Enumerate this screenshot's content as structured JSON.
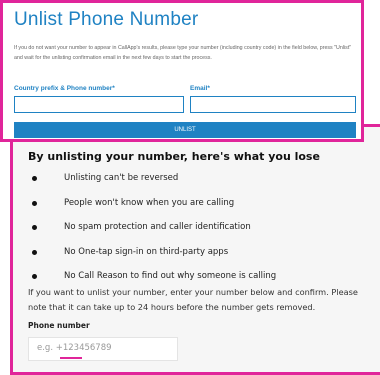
{
  "unlist_form": {
    "title": "Unlist Phone Number",
    "description": "If you do not want your number to appear in CallApp's results, please type your number (including country code) in the field below, press \"Unlist\" and wait for the unlisting confirmation email in the next few days to start the process.",
    "phone_label": "Country prefix & Phone number*",
    "email_label": "Email*",
    "phone_value": "",
    "email_value": "",
    "button_label": "UNLIST"
  },
  "unlist_info": {
    "heading": "By unlisting your number, here's what you lose",
    "losses": [
      "Unlisting can't be reversed",
      "People won't know when you are calling",
      "No spam protection and caller identification",
      "No One-tap sign-in on third-party apps",
      "No Call Reason to find out why someone is calling"
    ],
    "paragraph": "If you want to unlist your number, enter your number below and confirm. Please note that it can take up to 24 hours before the number gets removed.",
    "phone_label": "Phone number",
    "phone_placeholder": "e.g. +123456789"
  },
  "colors": {
    "brand_blue": "#1f82c3",
    "highlight_magenta": "#e0259a",
    "panel_gray": "#f6f6f6"
  }
}
